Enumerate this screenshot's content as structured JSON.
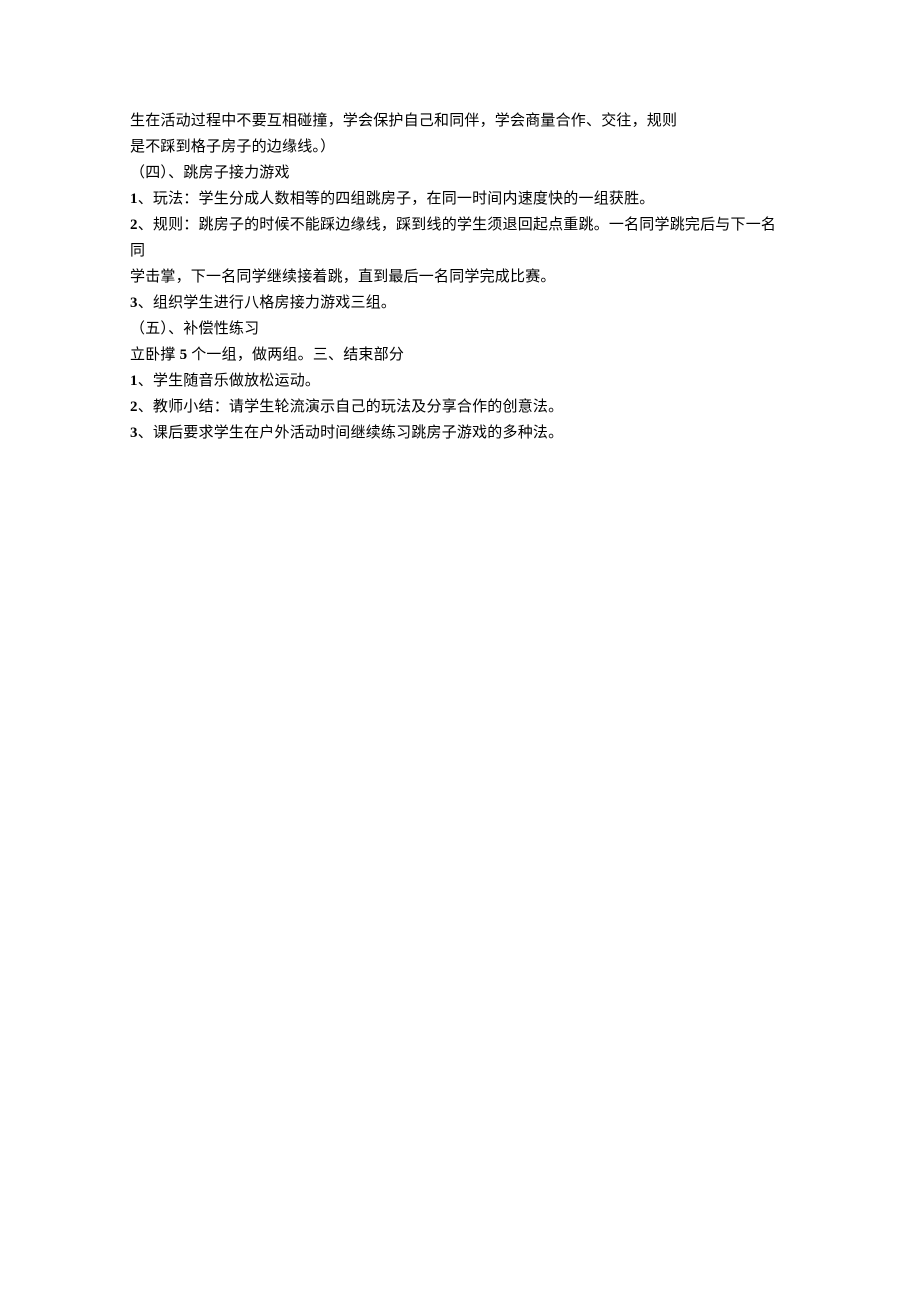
{
  "lines": [
    {
      "segments": [
        {
          "text": "生在活动过程中不要互相碰撞，学会保护自己和同伴，学会商量合作、交往，规则"
        }
      ]
    },
    {
      "segments": [
        {
          "text": "是不踩到格子房子的边缘线。）"
        }
      ]
    },
    {
      "segments": [
        {
          "text": "（四）、跳房子接力游戏"
        }
      ]
    },
    {
      "segments": [
        {
          "text": "1",
          "marker": true
        },
        {
          "text": "、玩法：学生分成人数相等的四组跳房子，在同一时间内速度快的一组获胜。"
        }
      ]
    },
    {
      "segments": [
        {
          "text": "2",
          "marker": true
        },
        {
          "text": "、规则：跳房子的时候不能踩边缘线，踩到线的学生须退回起点重跳。一名同学跳完后与下一名同"
        }
      ]
    },
    {
      "segments": [
        {
          "text": "学击掌，下一名同学继续接着跳，直到最后一名同学完成比赛。"
        }
      ]
    },
    {
      "segments": [
        {
          "text": "3",
          "marker": true
        },
        {
          "text": "、组织学生进行八格房接力游戏三组。"
        }
      ]
    },
    {
      "segments": [
        {
          "text": "（五）、补偿性练习"
        }
      ]
    },
    {
      "segments": [
        {
          "text": "立卧撑 "
        },
        {
          "text": "5",
          "marker": true
        },
        {
          "text": " 个一组，做两组。三、结束部分"
        }
      ]
    },
    {
      "segments": [
        {
          "text": "1",
          "marker": true
        },
        {
          "text": "、学生随音乐做放松运动。"
        }
      ]
    },
    {
      "segments": [
        {
          "text": "2",
          "marker": true
        },
        {
          "text": "、教师小结：请学生轮流演示自己的玩法及分享合作的创意法。"
        }
      ]
    },
    {
      "segments": [
        {
          "text": "3",
          "marker": true
        },
        {
          "text": "、课后要求学生在户外活动时间继续练习跳房子游戏的多种法。"
        }
      ]
    }
  ]
}
